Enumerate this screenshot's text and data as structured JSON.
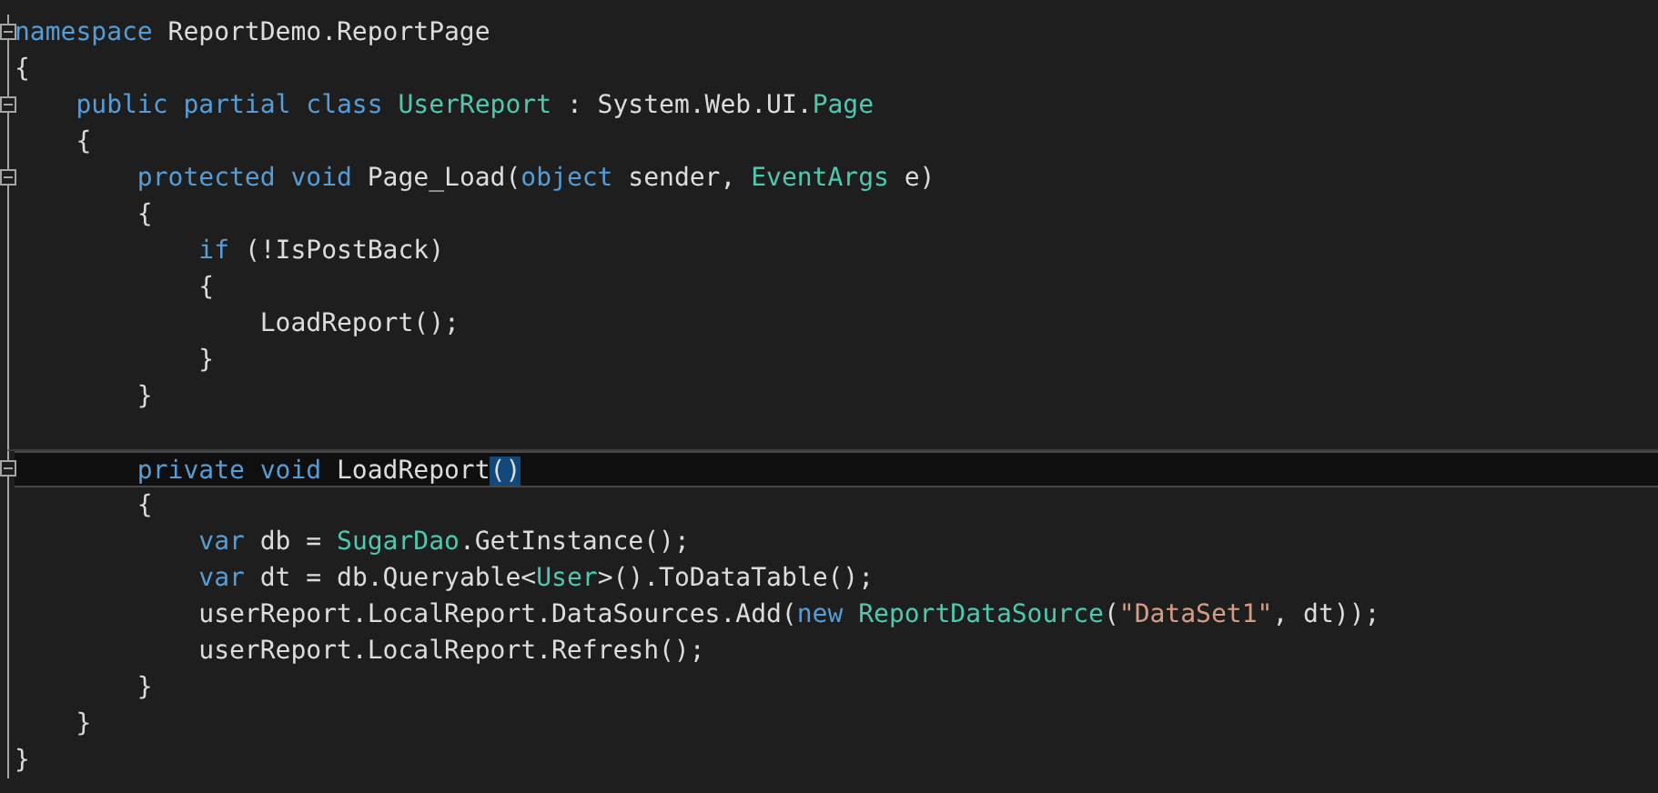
{
  "editor": {
    "lines": [
      {
        "expanded": true,
        "tokens": [
          {
            "text": "namespace",
            "kind": "keyword"
          },
          {
            "text": " ReportDemo.ReportPage",
            "kind": "plain"
          }
        ]
      },
      {
        "tokens": [
          {
            "text": "{",
            "kind": "plain"
          }
        ]
      },
      {
        "expanded": true,
        "tokens": [
          {
            "text": "    public partial class ",
            "kind": "keyword"
          },
          {
            "text": "UserReport",
            "kind": "type"
          },
          {
            "text": " : System.Web.UI.",
            "kind": "plain"
          },
          {
            "text": "Page",
            "kind": "type"
          }
        ]
      },
      {
        "tokens": [
          {
            "text": "    {",
            "kind": "plain"
          }
        ]
      },
      {
        "expanded": true,
        "tokens": [
          {
            "text": "        protected void",
            "kind": "keyword"
          },
          {
            "text": " Page_Load(",
            "kind": "plain"
          },
          {
            "text": "object",
            "kind": "keyword"
          },
          {
            "text": " sender, ",
            "kind": "plain"
          },
          {
            "text": "EventArgs",
            "kind": "type"
          },
          {
            "text": " e)",
            "kind": "plain"
          }
        ]
      },
      {
        "tokens": [
          {
            "text": "        {",
            "kind": "plain"
          }
        ]
      },
      {
        "tokens": [
          {
            "text": "            if",
            "kind": "keyword"
          },
          {
            "text": " (!IsPostBack)",
            "kind": "plain"
          }
        ]
      },
      {
        "tokens": [
          {
            "text": "            {",
            "kind": "plain"
          }
        ]
      },
      {
        "tokens": [
          {
            "text": "                LoadReport();",
            "kind": "plain"
          }
        ]
      },
      {
        "tokens": [
          {
            "text": "            }",
            "kind": "plain"
          }
        ]
      },
      {
        "tokens": [
          {
            "text": "        }",
            "kind": "plain"
          }
        ]
      },
      {
        "separator": true,
        "current": true,
        "expanded": true,
        "tokens": [
          {
            "text": "        private void",
            "kind": "keyword"
          },
          {
            "text": " LoadReport",
            "kind": "plain"
          },
          {
            "text": "()",
            "kind": "match"
          }
        ]
      },
      {
        "tokens": [
          {
            "text": "        {",
            "kind": "plain"
          }
        ]
      },
      {
        "tokens": [
          {
            "text": "            var",
            "kind": "keyword"
          },
          {
            "text": " db = ",
            "kind": "plain"
          },
          {
            "text": "SugarDao",
            "kind": "type"
          },
          {
            "text": ".GetInstance();",
            "kind": "plain"
          }
        ]
      },
      {
        "tokens": [
          {
            "text": "            var",
            "kind": "keyword"
          },
          {
            "text": " dt = db.Queryable<",
            "kind": "plain"
          },
          {
            "text": "User",
            "kind": "type"
          },
          {
            "text": ">().ToDataTable();",
            "kind": "plain"
          }
        ]
      },
      {
        "tokens": [
          {
            "text": "            userReport.LocalReport.DataSources.Add(",
            "kind": "plain"
          },
          {
            "text": "new ",
            "kind": "keyword"
          },
          {
            "text": "ReportDataSource",
            "kind": "type"
          },
          {
            "text": "(",
            "kind": "plain"
          },
          {
            "text": "\"DataSet1\"",
            "kind": "string"
          },
          {
            "text": ", dt));",
            "kind": "plain"
          }
        ]
      },
      {
        "tokens": [
          {
            "text": "            userReport.LocalReport.Refresh();",
            "kind": "plain"
          }
        ]
      },
      {
        "tokens": [
          {
            "text": "        }",
            "kind": "plain"
          }
        ]
      },
      {
        "tokens": [
          {
            "text": "    }",
            "kind": "plain"
          }
        ]
      },
      {
        "tokens": [
          {
            "text": "}",
            "kind": "plain"
          }
        ]
      }
    ]
  }
}
